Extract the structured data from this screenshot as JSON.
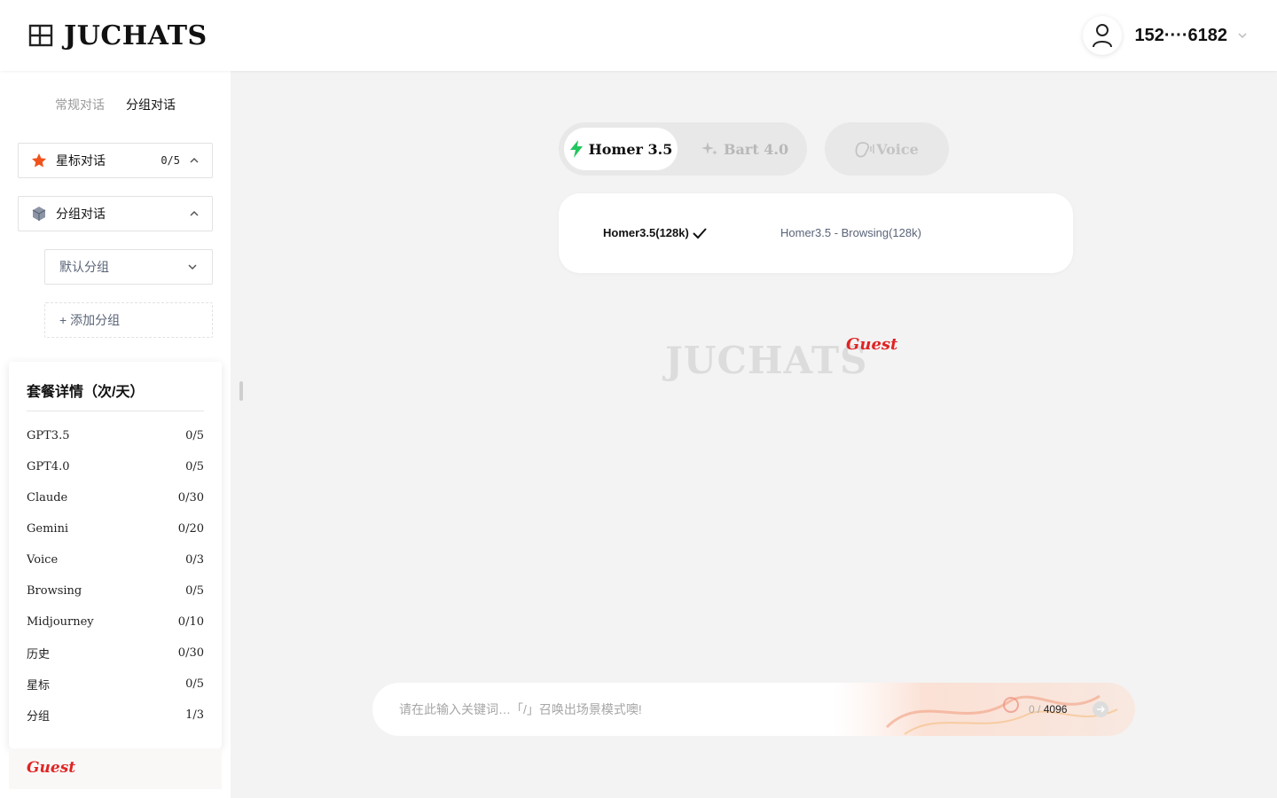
{
  "header": {
    "brand": "JUCHATS",
    "user_phone": "152····6182"
  },
  "sidebar": {
    "tabs": [
      {
        "label": "常规对话",
        "active": false
      },
      {
        "label": "分组对话",
        "active": true
      }
    ],
    "starred": {
      "label": "星标对话",
      "count": "0/5"
    },
    "groups": {
      "label": "分组对话"
    },
    "default_group": {
      "label": "默认分组"
    },
    "add_group": {
      "label": "+ 添加分组"
    },
    "plan": {
      "title": "套餐详情（次/天）",
      "rows": [
        {
          "name": "GPT3.5",
          "value": "0/5"
        },
        {
          "name": "GPT4.0",
          "value": "0/5"
        },
        {
          "name": "Claude",
          "value": "0/30"
        },
        {
          "name": "Gemini",
          "value": "0/20"
        },
        {
          "name": "Voice",
          "value": "0/3"
        },
        {
          "name": "Browsing",
          "value": "0/5"
        },
        {
          "name": "Midjourney",
          "value": "0/10"
        },
        {
          "name": "历史",
          "value": "0/30"
        },
        {
          "name": "星标",
          "value": "0/5"
        },
        {
          "name": "分组",
          "value": "1/3"
        }
      ]
    },
    "footer_badge": "Guest"
  },
  "main": {
    "modes": [
      {
        "label": "Homer 3.5",
        "active": true
      },
      {
        "label": "Bart 4.0",
        "active": false
      }
    ],
    "voice": {
      "label": "Voice"
    },
    "models": [
      {
        "label": "Homer3.5(128k)",
        "selected": true
      },
      {
        "label": "Homer3.5 - Browsing(128k)",
        "selected": false
      }
    ],
    "watermark": {
      "brand": "JUCHATS",
      "badge": "Guest"
    },
    "input": {
      "placeholder": "请在此输入关键词…「/」召唤出场景模式噢!",
      "value": "",
      "count": "0",
      "separator": "/",
      "max": "4096"
    }
  },
  "colors": {
    "accent_red": "#e02424",
    "star_orange": "#f0521b",
    "lightning_green": "#22c55e",
    "background": "#f3f3f3"
  },
  "icons": [
    "layout-icon",
    "user-icon",
    "chevron-down-icon",
    "star-icon",
    "box-icon",
    "chevron-up-icon",
    "lightning-icon",
    "sparkles-icon",
    "voice-icon",
    "check-icon",
    "send-icon"
  ]
}
